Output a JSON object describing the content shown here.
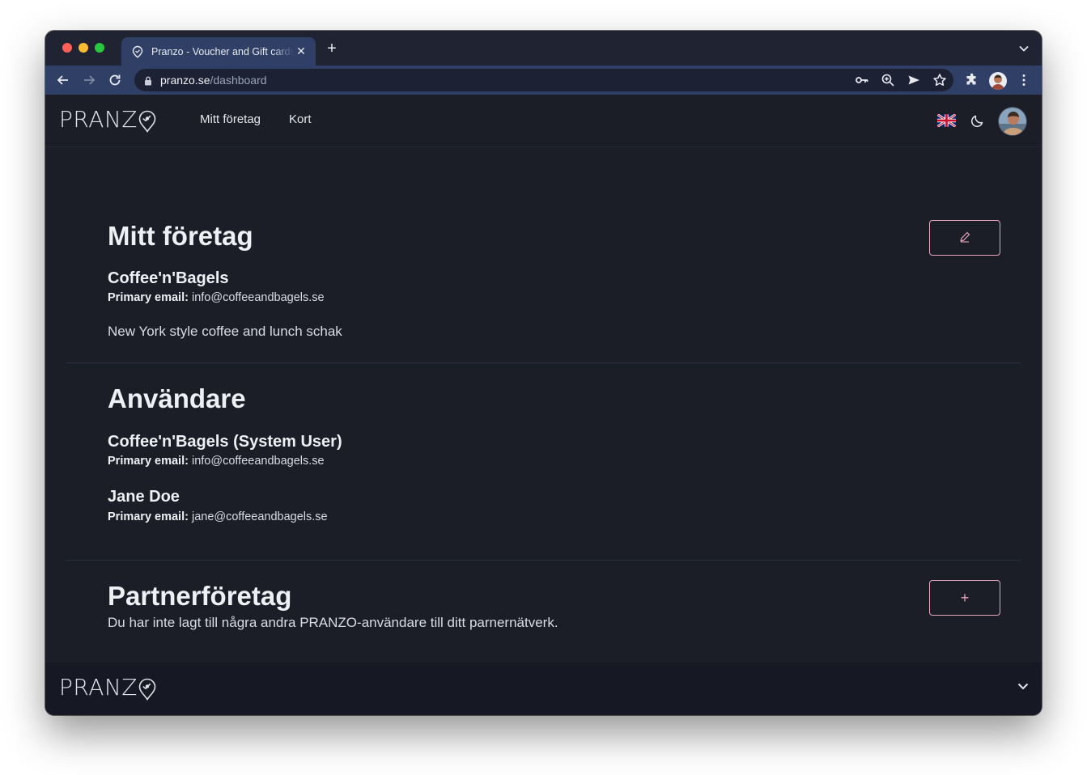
{
  "browser": {
    "tab_title": "Pranzo - Voucher and Gift cards",
    "url_host": "pranzo.se",
    "url_path": "/dashboard",
    "icons": [
      "back-icon",
      "forward-icon",
      "reload-icon",
      "lock-icon",
      "key-icon",
      "zoom-icon",
      "send-icon",
      "star-icon",
      "extensions-icon",
      "kebab-menu-icon",
      "tab-list-icon",
      "new-tab-icon",
      "close-icon"
    ]
  },
  "header": {
    "logo_text": "PRANZ",
    "nav": [
      "Mitt företag",
      "Kort"
    ]
  },
  "company": {
    "title": "Mitt företag",
    "name": "Coffee'n'Bagels",
    "email_label": "Primary email:",
    "email": "info@coffeeandbagels.se",
    "description": "New York style coffee and lunch schak"
  },
  "users": {
    "title": "Användare",
    "items": [
      {
        "name": "Coffee'n'Bagels (System User)",
        "email_label": "Primary email:",
        "email": "info@coffeeandbagels.se"
      },
      {
        "name": "Jane Doe",
        "email_label": "Primary email:",
        "email": "jane@coffeeandbagels.se"
      }
    ]
  },
  "partners": {
    "title": "Partnerföretag",
    "empty_text": "Du har inte lagt till några andra PRANZO-användare till ditt parnernätverk.",
    "add_label": "+"
  },
  "footer": {
    "logo_text": "PRANZ"
  },
  "colors": {
    "page_bg": "#1b1e27",
    "footer_bg": "#161923",
    "accent_pink": "#e6a4bd",
    "browser_toolbar": "#2f3f66"
  }
}
